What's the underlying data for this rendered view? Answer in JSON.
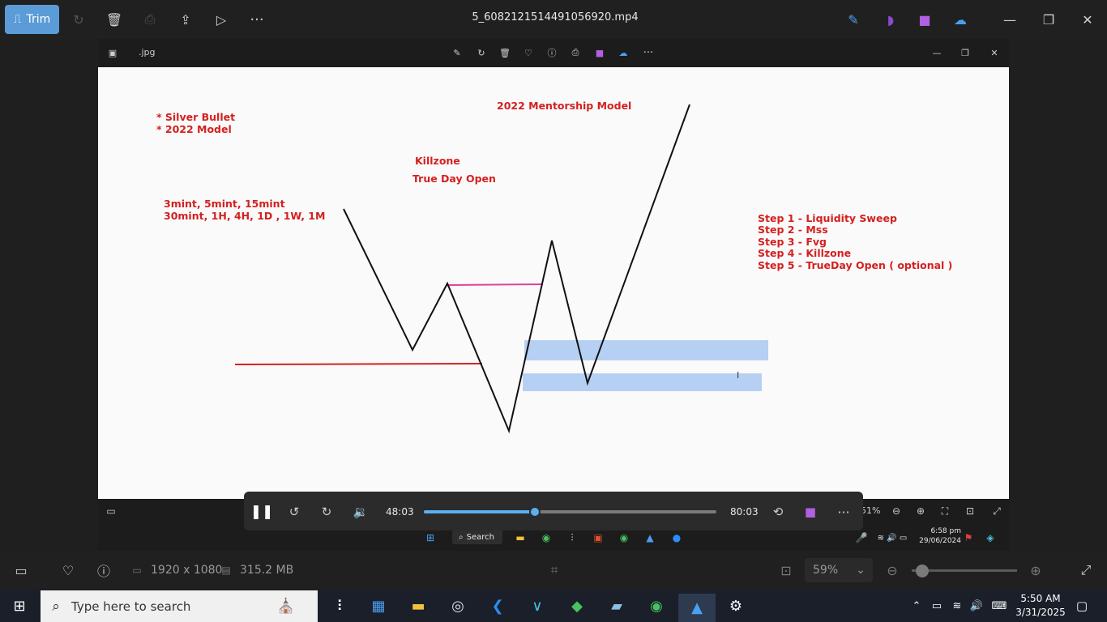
{
  "outer_toolbar": {
    "trim_label": "Trim",
    "file_title": "5_6082121514491056920.mp4"
  },
  "inner_window": {
    "file_label": ".jpg"
  },
  "whiteboard": {
    "top_left_lines": "* Silver Bullet\n* 2022 Model",
    "title": "2022 Mentorship Model",
    "killzone": "Killzone",
    "true_day_open": "True Day Open",
    "timeframes": "3mint, 5mint, 15mint\n30mint, 1H, 4H, 1D , 1W, 1M",
    "steps": [
      "Step 1 - Liquidity Sweep",
      "Step 2 - Mss",
      "Step 3 - Fvg",
      "Step 4 - Killzone",
      "Step 5 - TrueDay Open ( optional )"
    ],
    "colors": {
      "text": "#d42020",
      "sweep_line": "#d42020",
      "mss_line": "#e040a0",
      "fvg_box": "#a8c8f0"
    }
  },
  "player": {
    "current_time": "48:03",
    "total_time": "80:03",
    "progress": 0.38
  },
  "inner_viewer": {
    "zoom_pct": "51%",
    "mini_clock_time": "6:58 pm",
    "mini_clock_date": "29/06/2024",
    "mini_search": "Search"
  },
  "app_bottom": {
    "dimensions": "1920 x 1080",
    "size": "315.2 MB",
    "zoom": "59%",
    "zoom_level": 0.1
  },
  "taskbar": {
    "search_placeholder": "Type here to search",
    "time": "5:50 AM",
    "date": "3/31/2025"
  }
}
